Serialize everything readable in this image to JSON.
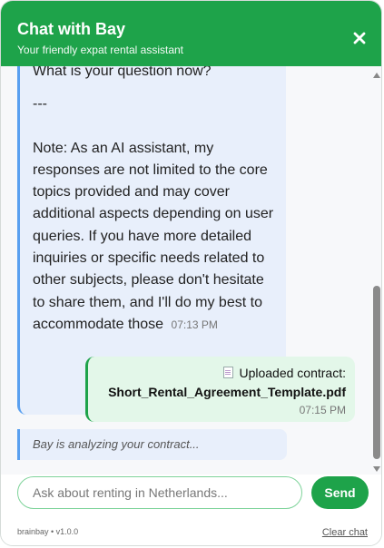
{
  "header": {
    "title": "Chat with Bay",
    "subtitle": "Your friendly expat rental assistant",
    "close_icon": "close-icon"
  },
  "messages": {
    "bot": {
      "lines": [
        "What is your question now?",
        "---",
        "Note: As an AI assistant, my responses are not limited to the core topics provided and may cover additional aspects depending on user queries. If you have more detailed inquiries or specific needs related to other subjects, please don't hesitate to share them, and I'll do my best to accommodate those"
      ],
      "time": "07:13 PM"
    },
    "user": {
      "label": "Uploaded contract:",
      "filename": "Short_Rental_Agreement_Template.pdf",
      "time": "07:15 PM",
      "icon": "document-icon"
    },
    "status": "Bay is analyzing your contract..."
  },
  "composer": {
    "placeholder": "Ask about renting in Netherlands...",
    "send_label": "Send"
  },
  "footer": {
    "brand": "brainbay • v1.0.0",
    "clear_label": "Clear chat"
  },
  "colors": {
    "accent": "#1ea34a",
    "bot_bubble": "#e8effb",
    "bot_border": "#5aa0f0",
    "user_bubble": "#e3f7e9"
  }
}
